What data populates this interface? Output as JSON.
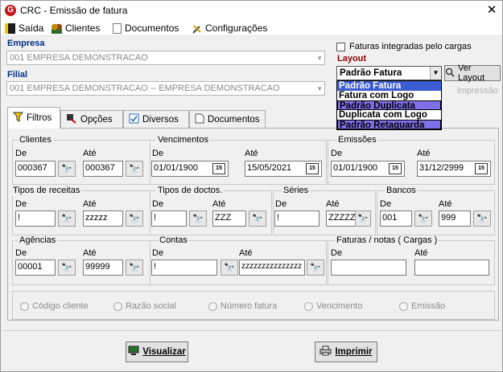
{
  "window": {
    "title": "CRC - Emissão de fatura",
    "close": "✕"
  },
  "menu": {
    "saida": "Saída",
    "clientes": "Clientes",
    "documentos": "Documentos",
    "configuracoes": "Configurações"
  },
  "empresa": {
    "label": "Empresa",
    "value": "001 EMPRESA DEMONSTRACAO"
  },
  "filial": {
    "label": "Filial",
    "value": "001 EMPRESA DEMONSTRACAO -- EMPRESA DEMONSTRACAO"
  },
  "faturas_cargas": {
    "label": "Faturas integradas pelo cargas",
    "checked": false
  },
  "layout": {
    "label": "Layout",
    "selected": "Padrão Fatura",
    "ver_layout": "Ver Layout",
    "hidden_text": "impressão",
    "options": [
      "Padrão Fatura",
      "Fatura com Logo",
      "Padrão Duplicata",
      "Duplicata com Logo",
      "Padrão Retaguarda"
    ]
  },
  "tabs": [
    "Filtros",
    "Opções",
    "Diversos",
    "Documentos"
  ],
  "labels": {
    "de": "De",
    "ate": "Até"
  },
  "filters": {
    "clientes": {
      "title": "Clientes",
      "de": "000367",
      "ate": "000367"
    },
    "vencimentos": {
      "title": "Vencimentos",
      "de": "01/01/1900",
      "ate": "15/05/2021"
    },
    "emissoes": {
      "title": "Emissões",
      "de": "01/01/1900",
      "ate": "31/12/2999"
    },
    "tipos_receitas": {
      "title": "Tipos de receitas",
      "de": "!",
      "ate": "zzzzz"
    },
    "tipos_doctos": {
      "title": "Tipos de doctos.",
      "de": "!",
      "ate": "ZZZ"
    },
    "series": {
      "title": "Séries",
      "de": "!",
      "ate": "ZZZZZ"
    },
    "bancos": {
      "title": "Bancos",
      "de": "001",
      "ate": "999"
    },
    "agencias": {
      "title": "Agências",
      "de": "00001",
      "ate": "99999"
    },
    "contas": {
      "title": "Contas",
      "de": "!",
      "ate": "zzzzzzzzzzzzzzz"
    },
    "faturas_notas": {
      "title": "Faturas / notas ( Cargas )",
      "de": "",
      "ate": ""
    }
  },
  "order": {
    "options": [
      "Código cliente",
      "Razão social",
      "Número fatura",
      "Vencimento",
      "Emissão"
    ]
  },
  "buttons": {
    "visualizar": "Visualizar",
    "imprimir": "Imprimir"
  },
  "calendar_text": "15",
  "colors": {
    "section_label": "#002f87",
    "layout_label": "#8b0000",
    "dropdown_selected": "#3b5bd0",
    "dropdown_highlight": "#7f6fe8"
  }
}
